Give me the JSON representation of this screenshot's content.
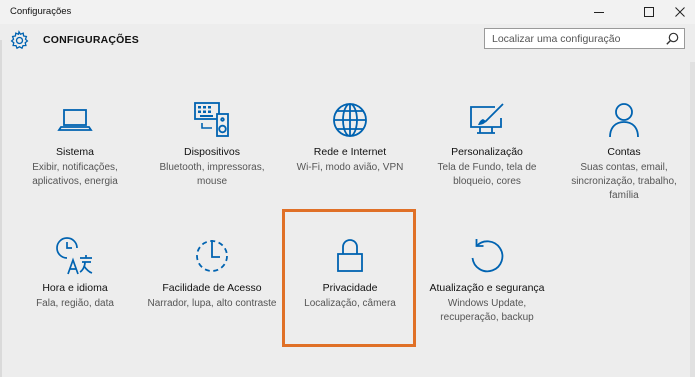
{
  "window": {
    "title": "Configurações",
    "controls": [
      "minimize",
      "maximize",
      "close"
    ]
  },
  "header": {
    "title": "CONFIGURAÇÕES",
    "icon": "gear-icon"
  },
  "search": {
    "placeholder": "Localizar uma configuração",
    "icon": "search-icon"
  },
  "accent_color": "#0063b1",
  "highlight_color": "#e07027",
  "tiles": [
    {
      "label": "Sistema",
      "desc": "Exibir, notificações, aplicativos, energia",
      "icon": "laptop-icon"
    },
    {
      "label": "Dispositivos",
      "desc": "Bluetooth, impressoras, mouse",
      "icon": "devices-icon"
    },
    {
      "label": "Rede e Internet",
      "desc": "Wi-Fi, modo avião, VPN",
      "icon": "globe-icon"
    },
    {
      "label": "Personalização",
      "desc": "Tela de Fundo, tela de bloqueio, cores",
      "icon": "personalization-icon"
    },
    {
      "label": "Contas",
      "desc": "Suas contas, email, sincronização, trabalho, família",
      "icon": "person-icon"
    },
    {
      "label": "Hora e idioma",
      "desc": "Fala, região, data",
      "icon": "time-language-icon"
    },
    {
      "label": "Facilidade de Acesso",
      "desc": "Narrador, lupa, alto contraste",
      "icon": "ease-of-access-icon"
    },
    {
      "label": "Privacidade",
      "desc": "Localização, câmera",
      "icon": "lock-icon",
      "highlighted": true
    },
    {
      "label": "Atualização e segurança",
      "desc": "Windows Update, recuperação, backup",
      "icon": "update-icon"
    }
  ]
}
